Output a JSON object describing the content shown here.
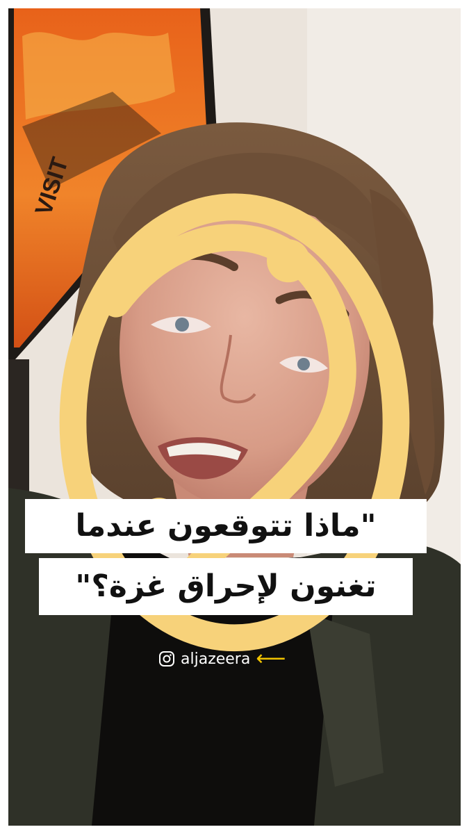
{
  "caption": {
    "line1": "\"ماذا تتوقعون عندما",
    "line2": "تغنون لإحراق غزة؟\""
  },
  "social": {
    "icon": "instagram-icon",
    "handle": "aljazeera",
    "arrow": "⟵",
    "arrow_color": "#f2c400"
  },
  "branding": {
    "logo": "aljazeera-logo"
  },
  "poster": {
    "visible_text": "VISIT"
  }
}
